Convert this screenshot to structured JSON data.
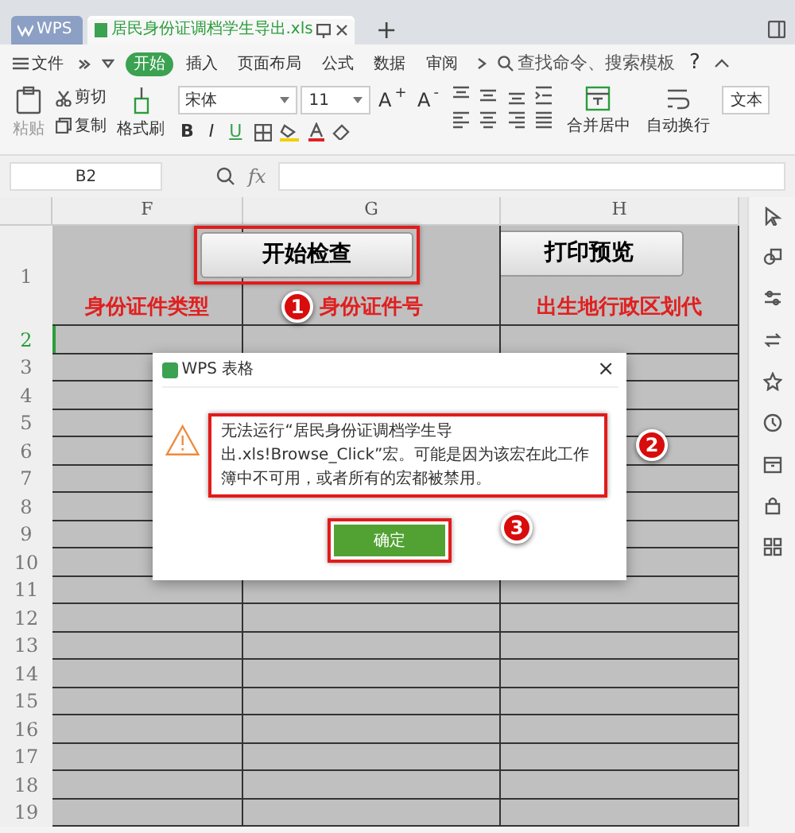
{
  "tabs": [
    {
      "label": "WPS",
      "kind": "home",
      "selected": false
    },
    {
      "label": "居民身份证调档学生导出.xls",
      "kind": "file",
      "selected": true
    }
  ],
  "new_tab": "+",
  "menu": {
    "file": "文件",
    "items": [
      {
        "label": "开始",
        "selected": true
      },
      {
        "label": "插入",
        "selected": false
      },
      {
        "label": "页面布局",
        "selected": false
      },
      {
        "label": "公式",
        "selected": false
      },
      {
        "label": "数据",
        "selected": false
      },
      {
        "label": "审阅",
        "selected": false
      }
    ],
    "search_placeholder": "查找命令、搜索模板",
    "help": "?"
  },
  "ribbon": {
    "paste": "粘贴",
    "cut": "剪切",
    "copy": "复制",
    "format_painter": "格式刷",
    "font_name": "宋体",
    "font_size": "11",
    "grow": "A$^{+}$",
    "shrink": "A$^{-}$",
    "bold": "B",
    "italic": "I",
    "underline": "U",
    "merge": "合并居中",
    "wrap": "自动换行",
    "number_format": "文本"
  },
  "formula_bar": {
    "cell_ref": "B2",
    "fx": "fx"
  },
  "sheet": {
    "columns": [
      "F",
      "G",
      "H"
    ],
    "buttons": [
      "开始检查",
      "打印预览"
    ],
    "headers": [
      "身份证件类型",
      "身份证件号",
      "出生地行政区划代"
    ],
    "rows": [
      {
        "label": "1",
        "selected": false
      },
      {
        "label": "2",
        "selected": true
      },
      {
        "label": "3",
        "selected": false
      },
      {
        "label": "4",
        "selected": false
      },
      {
        "label": "5",
        "selected": false
      },
      {
        "label": "6",
        "selected": false
      },
      {
        "label": "7",
        "selected": false
      },
      {
        "label": "8",
        "selected": false
      },
      {
        "label": "9",
        "selected": false
      },
      {
        "label": "10",
        "selected": false
      },
      {
        "label": "11",
        "selected": false
      },
      {
        "label": "12",
        "selected": false
      },
      {
        "label": "13",
        "selected": false
      },
      {
        "label": "14",
        "selected": false
      },
      {
        "label": "15",
        "selected": false
      },
      {
        "label": "16",
        "selected": false
      },
      {
        "label": "17",
        "selected": false
      },
      {
        "label": "18",
        "selected": false
      },
      {
        "label": "19",
        "selected": false
      }
    ]
  },
  "dialog": {
    "title": "WPS 表格",
    "close": "×",
    "message": "无法运行“居民身份证调档学生导出.xls!Browse_Click”宏。可能是因为该宏在此工作簿中不可用，或者所有的宏都被禁用。",
    "ok": "确定"
  },
  "annotations": [
    "1",
    "2",
    "3"
  ]
}
